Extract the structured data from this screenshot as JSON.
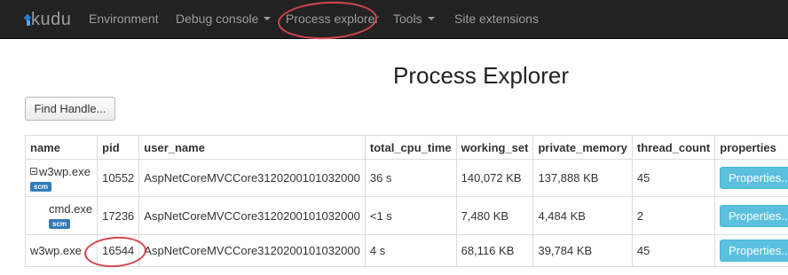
{
  "navbar": {
    "brand": "kudu",
    "items": [
      {
        "label": "Environment"
      },
      {
        "label": "Debug console"
      },
      {
        "label": "Process explorer"
      },
      {
        "label": "Tools"
      },
      {
        "label": "Site extensions"
      }
    ]
  },
  "page": {
    "title": "Process Explorer",
    "find_handle_label": "Find Handle..."
  },
  "table": {
    "columns": [
      "name",
      "pid",
      "user_name",
      "total_cpu_time",
      "working_set",
      "private_memory",
      "thread_count",
      "properties"
    ],
    "rows": [
      {
        "name": "w3wp.exe",
        "badge": "scm",
        "pid": "10552",
        "user_name": "AspNetCoreMVCCore3120200101032000",
        "total_cpu_time": "36 s",
        "working_set": "140,072 KB",
        "private_memory": "137,888 KB",
        "thread_count": "45",
        "properties": "Properties.."
      },
      {
        "name": "cmd.exe",
        "badge": "scm",
        "pid": "17236",
        "user_name": "AspNetCoreMVCCore3120200101032000",
        "total_cpu_time": "<1 s",
        "working_set": "7,480 KB",
        "private_memory": "4,484 KB",
        "thread_count": "2",
        "properties": "Properties.."
      },
      {
        "name": "w3wp.exe",
        "pid": "16544",
        "user_name": "AspNetCoreMVCCore3120200101032000",
        "total_cpu_time": "4 s",
        "working_set": "68,116 KB",
        "private_memory": "39,784 KB",
        "thread_count": "45",
        "properties": "Properties.."
      }
    ]
  },
  "colors": {
    "navbar_bg": "#222222",
    "nav_text": "#9d9d9d",
    "annotation_red": "#d64550",
    "info_button": "#5bc0de",
    "badge": "#337ab7"
  }
}
